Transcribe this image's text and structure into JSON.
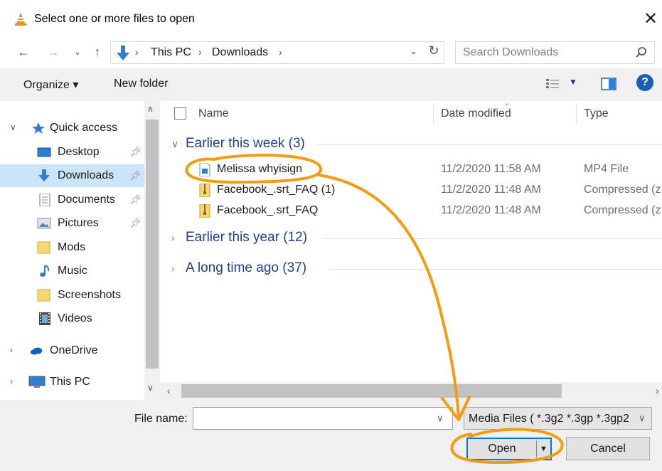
{
  "window": {
    "title": "Select one or more files to open"
  },
  "address": {
    "breadcrumbs": [
      "This PC",
      "Downloads"
    ],
    "search_placeholder": "Search Downloads"
  },
  "toolbar": {
    "organize_label": "Organize ▾",
    "new_folder_label": "New folder",
    "help_label": "?"
  },
  "sidebar": {
    "quick_access": "Quick access",
    "items": [
      {
        "label": "Desktop",
        "icon": "desktop-icon",
        "pinned": true
      },
      {
        "label": "Downloads",
        "icon": "download-icon",
        "pinned": true,
        "selected": true
      },
      {
        "label": "Documents",
        "icon": "documents-icon",
        "pinned": true
      },
      {
        "label": "Pictures",
        "icon": "pictures-icon",
        "pinned": true
      },
      {
        "label": "Mods",
        "icon": "folder-icon",
        "pinned": false
      },
      {
        "label": "Music",
        "icon": "music-icon",
        "pinned": false
      },
      {
        "label": "Screenshots",
        "icon": "folder-icon",
        "pinned": false
      },
      {
        "label": "Videos",
        "icon": "videos-icon",
        "pinned": false
      }
    ],
    "onedrive": "OneDrive",
    "this_pc": "This PC"
  },
  "columns": {
    "name": "Name",
    "date": "Date modified",
    "type": "Type"
  },
  "groups": [
    {
      "label": "Earlier this week (3)",
      "expanded": true,
      "files": [
        {
          "name": "Melissa whyisign",
          "date": "11/2/2020 11:58 AM",
          "type": "MP4 File",
          "icon": "video-file-icon"
        },
        {
          "name": "Facebook_.srt_FAQ (1)",
          "date": "11/2/2020 11:48 AM",
          "type": "Compressed (z",
          "icon": "zip-file-icon"
        },
        {
          "name": "Facebook_.srt_FAQ",
          "date": "11/2/2020 11:48 AM",
          "type": "Compressed (z",
          "icon": "zip-file-icon"
        }
      ]
    },
    {
      "label": "Earlier this year (12)",
      "expanded": false
    },
    {
      "label": "A long time ago (37)",
      "expanded": false
    }
  ],
  "footer": {
    "file_name_label": "File name:",
    "file_name_value": "",
    "filter_text": "Media Files ( *.3g2 *.3gp *.3gp2",
    "open_label": "Open",
    "cancel_label": "Cancel"
  },
  "colors": {
    "selection": "#cce4f7",
    "annotation": "#f39c12",
    "accent": "#0078d7",
    "group_text": "#1e3f8a"
  }
}
